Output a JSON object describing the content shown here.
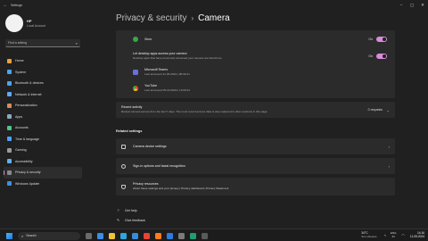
{
  "window": {
    "title": "Settings"
  },
  "profile": {
    "name": "HP",
    "subtitle": "Local Account"
  },
  "search": {
    "placeholder": "Find a setting"
  },
  "nav": [
    {
      "label": "Home",
      "color": "#e8a13a"
    },
    {
      "label": "System",
      "color": "#4aa3ff"
    },
    {
      "label": "Bluetooth & devices",
      "color": "#4aa3ff"
    },
    {
      "label": "Network & internet",
      "color": "#5fa8ff"
    },
    {
      "label": "Personalization",
      "color": "#d98c5a"
    },
    {
      "label": "Apps",
      "color": "#8fa6c2"
    },
    {
      "label": "Accounts",
      "color": "#4fc38a"
    },
    {
      "label": "Time & language",
      "color": "#4aa3ff"
    },
    {
      "label": "Gaming",
      "color": "#9a9a9a"
    },
    {
      "label": "Accessibility",
      "color": "#5fb0ff"
    },
    {
      "label": "Privacy & security",
      "color": "#8a8a8a",
      "active": true
    },
    {
      "label": "Windows Update",
      "color": "#3f8fe0"
    }
  ],
  "breadcrumb": {
    "parent": "Privacy & security",
    "separator": "›",
    "current": "Camera"
  },
  "apps": {
    "xbox": {
      "name": "Xbox",
      "state": "On"
    },
    "desktop": {
      "title": "Let desktop apps access your camera",
      "desc": "Desktop apps that have previously accessed your camera are listed here",
      "state": "On"
    },
    "teams": {
      "name": "Microsoft Teams",
      "last": "Last accessed 11-05-2024 | 08:39:21"
    },
    "youtube": {
      "name": "YouTube",
      "last": "Last accessed 05-04-2024 | 13:00:01"
    }
  },
  "recent": {
    "title": "Recent activity",
    "desc": "Review camera access from the last 7 days. The most recent access data is also captured in other sections in this page",
    "count": "0 requests"
  },
  "related": {
    "heading": "Related settings",
    "camera_settings": "Camera device settings",
    "signin": "Sign-in options and facial recognition",
    "privacy_title": "Privacy resources",
    "privacy_links": "About these settings and your privacy | Privacy dashboard | Privacy Statement"
  },
  "links": {
    "help": "Get help",
    "feedback": "Give feedback"
  },
  "taskbar": {
    "search": "Search",
    "weather_temp": "34°C",
    "weather_desc": "Sun showers",
    "lang_top": "ENG",
    "lang_bottom": "IN",
    "time": "14:16",
    "date": "11-05-2024"
  }
}
